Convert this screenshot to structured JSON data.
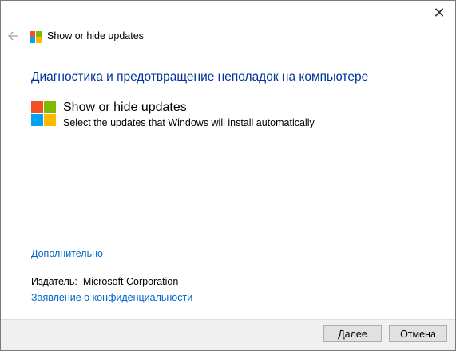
{
  "window": {
    "title": "Show or hide updates",
    "close_glyph": "✕"
  },
  "heading": "Диагностика и предотвращение неполадок на компьютере",
  "task": {
    "title": "Show or hide updates",
    "description": "Select the updates that Windows will install automatically",
    "icon": "windows-logo-icon"
  },
  "links": {
    "advanced": "Дополнительно",
    "privacy": "Заявление о конфиденциальности"
  },
  "publisher": {
    "label": "Издатель:",
    "value": "Microsoft Corporation"
  },
  "buttons": {
    "next": "Далее",
    "cancel": "Отмена"
  },
  "colors": {
    "heading": "#003399",
    "link": "#0066cc",
    "logo_red": "#f25022",
    "logo_green": "#7fba00",
    "logo_blue": "#00a4ef",
    "logo_yellow": "#ffb900"
  }
}
